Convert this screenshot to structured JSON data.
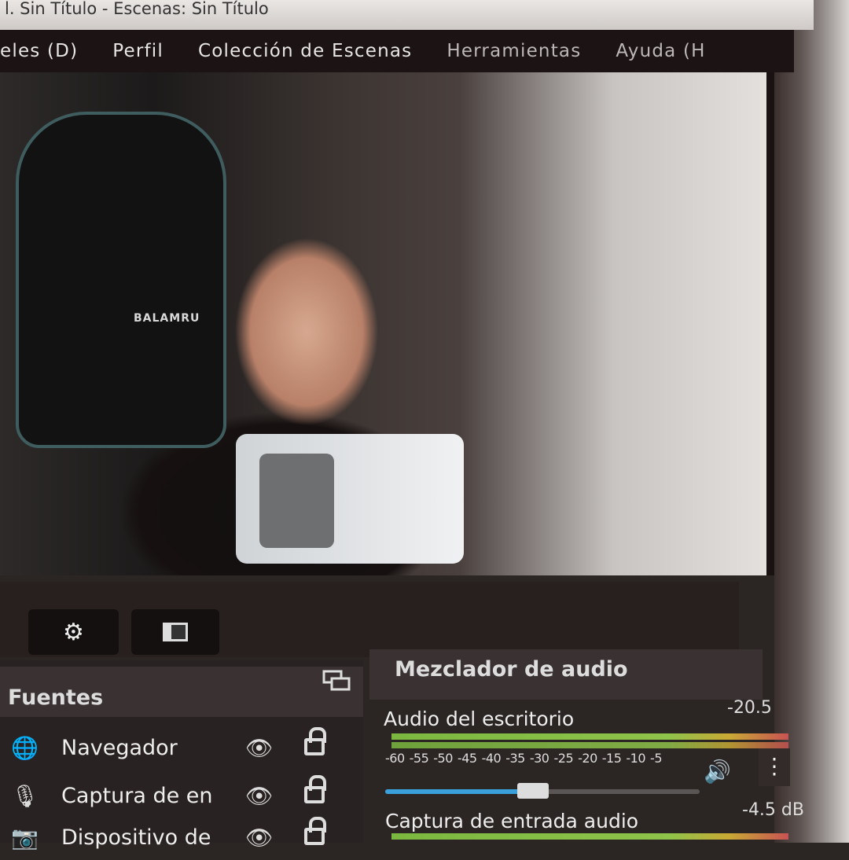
{
  "window": {
    "title": "l. Sin Título - Escenas: Sin Título"
  },
  "menu": [
    {
      "label": "eles (D)"
    },
    {
      "label": "Perfil"
    },
    {
      "label": "Colección de Escenas"
    },
    {
      "label": "Herramientas"
    },
    {
      "label": "Ayuda (H"
    }
  ],
  "preview": {
    "chair_brand": "BALAMRU"
  },
  "sources": {
    "title": "Fuentes",
    "items": [
      {
        "label": "Navegador",
        "icon": "globe-icon"
      },
      {
        "label": "Captura de en",
        "icon": "microphone-icon"
      },
      {
        "label": "Dispositivo de",
        "icon": "camera-icon"
      }
    ]
  },
  "mixer": {
    "title": "Mezclador de audio",
    "channels": [
      {
        "name": "Audio del escritorio",
        "db": "-20.5",
        "volume_fraction": 0.47
      },
      {
        "name": "Captura de entrada audio",
        "db": "-4.5 dB"
      }
    ],
    "ticks": [
      "-60",
      "-55",
      "-50",
      "-45",
      "-40",
      "-35",
      "-30",
      "-25",
      "-20",
      "-15",
      "-10",
      "-5"
    ]
  },
  "colors": {
    "meter_green": "#7bb840",
    "volume_blue": "#3aa0d9",
    "background": "#2b2524"
  }
}
